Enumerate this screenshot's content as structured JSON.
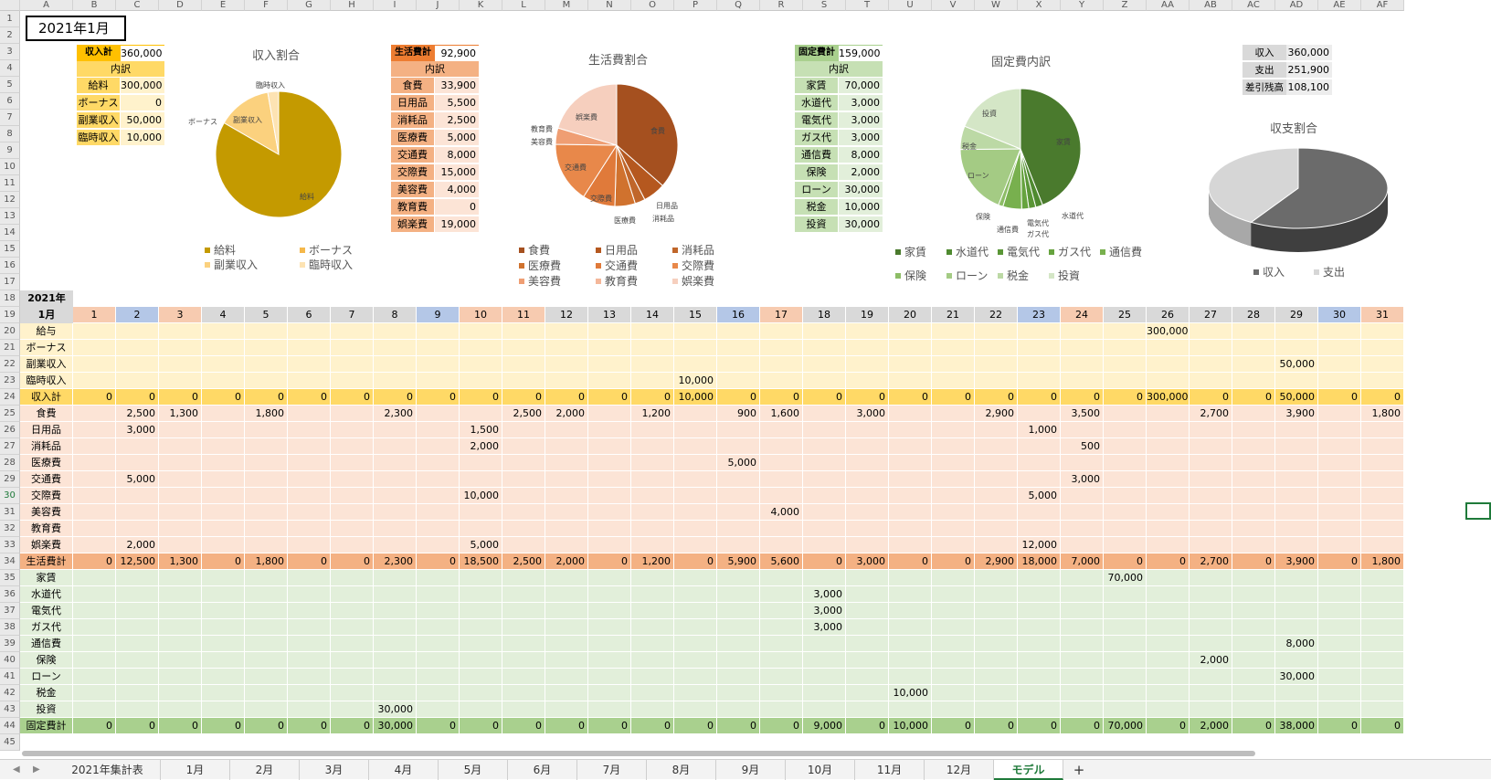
{
  "columns": [
    "A",
    "B",
    "C",
    "D",
    "E",
    "F",
    "G",
    "H",
    "I",
    "J",
    "K",
    "L",
    "M",
    "N",
    "O",
    "P",
    "Q",
    "R",
    "S",
    "T",
    "U",
    "V",
    "W",
    "X",
    "Y",
    "Z",
    "AA",
    "AB",
    "AC",
    "AD",
    "AE",
    "AF"
  ],
  "title_cell": "2021年1月",
  "income_summary": {
    "total_label": "収入計",
    "total_value": "360,000",
    "breakdown_label": "内訳",
    "rows": [
      {
        "label": "給料",
        "value": "300,000"
      },
      {
        "label": "ボーナス",
        "value": "0"
      },
      {
        "label": "副業収入",
        "value": "50,000"
      },
      {
        "label": "臨時収入",
        "value": "10,000"
      }
    ]
  },
  "living_summary": {
    "total_label": "生活費計",
    "total_value": "92,900",
    "breakdown_label": "内訳",
    "rows": [
      {
        "label": "食費",
        "value": "33,900"
      },
      {
        "label": "日用品",
        "value": "5,500"
      },
      {
        "label": "消耗品",
        "value": "2,500"
      },
      {
        "label": "医療費",
        "value": "5,000"
      },
      {
        "label": "交通費",
        "value": "8,000"
      },
      {
        "label": "交際費",
        "value": "15,000"
      },
      {
        "label": "美容費",
        "value": "4,000"
      },
      {
        "label": "教育費",
        "value": "0"
      },
      {
        "label": "娯楽費",
        "value": "19,000"
      }
    ]
  },
  "fixed_summary": {
    "total_label": "固定費計",
    "total_value": "159,000",
    "breakdown_label": "内訳",
    "rows": [
      {
        "label": "家賃",
        "value": "70,000"
      },
      {
        "label": "水道代",
        "value": "3,000"
      },
      {
        "label": "電気代",
        "value": "3,000"
      },
      {
        "label": "ガス代",
        "value": "3,000"
      },
      {
        "label": "通信費",
        "value": "8,000"
      },
      {
        "label": "保険",
        "value": "2,000"
      },
      {
        "label": "ローン",
        "value": "30,000"
      },
      {
        "label": "税金",
        "value": "10,000"
      },
      {
        "label": "投資",
        "value": "30,000"
      }
    ]
  },
  "balance_summary": {
    "rows": [
      {
        "label": "収入",
        "value": "360,000"
      },
      {
        "label": "支出",
        "value": "251,900"
      },
      {
        "label": "差引残高",
        "value": "108,100"
      }
    ]
  },
  "chart_data": [
    {
      "type": "pie",
      "title": "収入割合",
      "categories": [
        "給料",
        "ボーナス",
        "副業収入",
        "臨時収入"
      ],
      "values": [
        300000,
        0,
        50000,
        10000
      ],
      "colors": [
        "#c49a00",
        "#f5b84b",
        "#fbd17e",
        "#fde3b3"
      ],
      "legend": "bottom"
    },
    {
      "type": "pie",
      "title": "生活費割合",
      "categories": [
        "食費",
        "日用品",
        "消耗品",
        "医療費",
        "交通費",
        "交際費",
        "美容費",
        "教育費",
        "娯楽費"
      ],
      "values": [
        33900,
        5500,
        2500,
        5000,
        8000,
        15000,
        4000,
        0,
        19000
      ],
      "colors": [
        "#a5501f",
        "#b5581f",
        "#c0662a",
        "#d0722e",
        "#e07a3a",
        "#e8884a",
        "#ef9e73",
        "#f4b79a",
        "#f6cfbe"
      ],
      "legend": "bottom"
    },
    {
      "type": "pie",
      "title": "固定費内訳",
      "categories": [
        "家賃",
        "水道代",
        "電気代",
        "ガス代",
        "通信費",
        "保険",
        "ローン",
        "税金",
        "投資"
      ],
      "values": [
        70000,
        3000,
        3000,
        3000,
        8000,
        2000,
        30000,
        10000,
        30000
      ],
      "colors": [
        "#4a7a2d",
        "#4f8a30",
        "#5a9636",
        "#66a33e",
        "#78b04e",
        "#8dbd66",
        "#a4cb84",
        "#bcd9a5",
        "#d4e6c6"
      ],
      "legend": "bottom"
    },
    {
      "type": "pie",
      "title": "収支割合",
      "categories": [
        "収入",
        "支出"
      ],
      "values": [
        360000,
        251900
      ],
      "colors": [
        "#6b6b6b",
        "#d6d6d6"
      ],
      "legend": "bottom",
      "style": "3d"
    }
  ],
  "grid": {
    "year_label": "2021年",
    "month_label": "1月",
    "days": [
      "1",
      "2",
      "3",
      "4",
      "5",
      "6",
      "7",
      "8",
      "9",
      "10",
      "11",
      "12",
      "13",
      "14",
      "15",
      "16",
      "17",
      "18",
      "19",
      "20",
      "21",
      "22",
      "23",
      "24",
      "25",
      "26",
      "27",
      "28",
      "29",
      "30",
      "31"
    ],
    "day_colors": [
      "#f7cbb0",
      "#b4c7e7",
      "#f7cbb0",
      "#d9d9d9",
      "#d9d9d9",
      "#d9d9d9",
      "#d9d9d9",
      "#d9d9d9",
      "#b4c7e7",
      "#f7cbb0",
      "#f7cbb0",
      "#d9d9d9",
      "#d9d9d9",
      "#d9d9d9",
      "#d9d9d9",
      "#b4c7e7",
      "#f7cbb0",
      "#d9d9d9",
      "#d9d9d9",
      "#d9d9d9",
      "#d9d9d9",
      "#d9d9d9",
      "#b4c7e7",
      "#f7cbb0",
      "#d9d9d9",
      "#d9d9d9",
      "#d9d9d9",
      "#d9d9d9",
      "#d9d9d9",
      "#b4c7e7",
      "#f7cbb0"
    ],
    "rows": [
      {
        "n": "20",
        "label": "給与",
        "group": "income",
        "cells": {
          "26": "300,000"
        }
      },
      {
        "n": "21",
        "label": "ボーナス",
        "group": "income",
        "cells": {}
      },
      {
        "n": "22",
        "label": "副業収入",
        "group": "income",
        "cells": {
          "29": "50,000"
        }
      },
      {
        "n": "23",
        "label": "臨時収入",
        "group": "income",
        "cells": {
          "15": "10,000"
        }
      },
      {
        "n": "24",
        "label": "収入計",
        "group": "income_total",
        "values": [
          "0",
          "0",
          "0",
          "0",
          "0",
          "0",
          "0",
          "0",
          "0",
          "0",
          "0",
          "0",
          "0",
          "0",
          "10,000",
          "0",
          "0",
          "0",
          "0",
          "0",
          "0",
          "0",
          "0",
          "0",
          "0",
          "300,000",
          "0",
          "0",
          "50,000",
          "0",
          "0"
        ]
      },
      {
        "n": "25",
        "label": "食費",
        "group": "living",
        "cells": {
          "2": "2,500",
          "3": "1,300",
          "5": "1,800",
          "8": "2,300",
          "11": "2,500",
          "12": "2,000",
          "14": "1,200",
          "16": "900",
          "17": "1,600",
          "19": "3,000",
          "22": "2,900",
          "24": "3,500",
          "27": "2,700",
          "29": "3,900",
          "31": "1,800"
        }
      },
      {
        "n": "26",
        "label": "日用品",
        "group": "living",
        "cells": {
          "2": "3,000",
          "10": "1,500",
          "23": "1,000"
        }
      },
      {
        "n": "27",
        "label": "消耗品",
        "group": "living",
        "cells": {
          "10": "2,000",
          "24": "500"
        }
      },
      {
        "n": "28",
        "label": "医療費",
        "group": "living",
        "cells": {
          "16": "5,000"
        }
      },
      {
        "n": "29",
        "label": "交通費",
        "group": "living",
        "cells": {
          "2": "5,000",
          "24": "3,000"
        }
      },
      {
        "n": "30",
        "label": "交際費",
        "group": "living",
        "cells": {
          "10": "10,000",
          "23": "5,000"
        }
      },
      {
        "n": "31",
        "label": "美容費",
        "group": "living",
        "cells": {
          "17": "4,000"
        }
      },
      {
        "n": "32",
        "label": "教育費",
        "group": "living",
        "cells": {}
      },
      {
        "n": "33",
        "label": "娯楽費",
        "group": "living",
        "cells": {
          "2": "2,000",
          "10": "5,000",
          "23": "12,000"
        }
      },
      {
        "n": "34",
        "label": "生活費計",
        "group": "living_total",
        "values": [
          "0",
          "12,500",
          "1,300",
          "0",
          "1,800",
          "0",
          "0",
          "2,300",
          "0",
          "18,500",
          "2,500",
          "2,000",
          "0",
          "1,200",
          "0",
          "5,900",
          "5,600",
          "0",
          "3,000",
          "0",
          "0",
          "2,900",
          "18,000",
          "7,000",
          "0",
          "0",
          "2,700",
          "0",
          "3,900",
          "0",
          "1,800"
        ]
      },
      {
        "n": "35",
        "label": "家賃",
        "group": "fixed",
        "cells": {
          "25": "70,000"
        }
      },
      {
        "n": "36",
        "label": "水道代",
        "group": "fixed",
        "cells": {
          "18": "3,000"
        }
      },
      {
        "n": "37",
        "label": "電気代",
        "group": "fixed",
        "cells": {
          "18": "3,000"
        }
      },
      {
        "n": "38",
        "label": "ガス代",
        "group": "fixed",
        "cells": {
          "18": "3,000"
        }
      },
      {
        "n": "39",
        "label": "通信費",
        "group": "fixed",
        "cells": {
          "29": "8,000"
        }
      },
      {
        "n": "40",
        "label": "保険",
        "group": "fixed",
        "cells": {
          "27": "2,000"
        }
      },
      {
        "n": "41",
        "label": "ローン",
        "group": "fixed",
        "cells": {
          "29": "30,000"
        }
      },
      {
        "n": "42",
        "label": "税金",
        "group": "fixed",
        "cells": {
          "20": "10,000"
        }
      },
      {
        "n": "43",
        "label": "投資",
        "group": "fixed",
        "cells": {
          "8": "30,000"
        }
      },
      {
        "n": "44",
        "label": "固定費計",
        "group": "fixed_total",
        "values": [
          "0",
          "0",
          "0",
          "0",
          "0",
          "0",
          "0",
          "30,000",
          "0",
          "0",
          "0",
          "0",
          "0",
          "0",
          "0",
          "0",
          "0",
          "9,000",
          "0",
          "10,000",
          "0",
          "0",
          "0",
          "0",
          "70,000",
          "0",
          "2,000",
          "0",
          "38,000",
          "0",
          "0"
        ]
      }
    ]
  },
  "colors": {
    "income": "#fff2cc",
    "income_total": "#ffd966",
    "living": "#fce4d6",
    "living_total": "#f4b183",
    "fixed": "#e2efda",
    "fixed_total": "#a9d08e"
  },
  "tabs": [
    "2021年集計表",
    "1月",
    "2月",
    "3月",
    "4月",
    "5月",
    "6月",
    "7月",
    "8月",
    "9月",
    "10月",
    "11月",
    "12月",
    "モデル"
  ],
  "active_tab": "モデル",
  "add_sheet": "+"
}
